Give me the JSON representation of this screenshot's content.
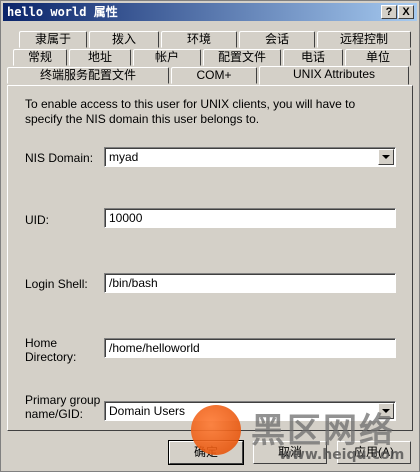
{
  "window": {
    "title": "hello world 属性",
    "help_button": "?",
    "close_button": "X"
  },
  "tabs": {
    "row1": [
      "隶属于",
      "拨入",
      "环境",
      "会话",
      "远程控制"
    ],
    "row2": [
      "常规",
      "地址",
      "帐户",
      "配置文件",
      "电话",
      "单位"
    ],
    "row3": [
      "终端服务配置文件",
      "COM+",
      "UNIX Attributes"
    ],
    "active": "UNIX Attributes"
  },
  "panel": {
    "info_text": "To enable access to this user for UNIX clients, you will have to specify the NIS domain this user belongs to.",
    "nis_domain": {
      "label": "NIS Domain:",
      "value": "myad"
    },
    "uid": {
      "label": "UID:",
      "value": "10000"
    },
    "login_shell": {
      "label": "Login Shell:",
      "value": "/bin/bash"
    },
    "home_directory": {
      "label_line1": "Home",
      "label_line2": "Directory:",
      "value": "/home/helloworld"
    },
    "primary_group": {
      "label_line1": "Primary group",
      "label_line2": "name/GID:",
      "value": "Domain Users"
    }
  },
  "buttons": {
    "ok": "确定",
    "cancel": "取消",
    "apply": "应用(A)"
  },
  "watermark": {
    "text": "黑区网络",
    "url": "www.heiqu.com"
  }
}
